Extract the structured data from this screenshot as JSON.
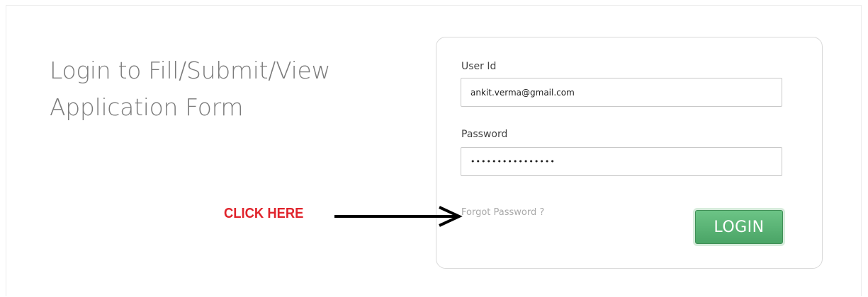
{
  "heading": {
    "line1": "Login to Fill/Submit/View",
    "line2": "Application Form"
  },
  "form": {
    "userid_label": "User Id",
    "userid_value": "ankit.verma@gmail.com",
    "password_label": "Password",
    "password_value": "••••••••••••••••",
    "forgot_link": "Forgot Password ?",
    "login_button": "LOGIN"
  },
  "annotation": {
    "text": "CLICK HERE",
    "icon": "arrow-right-icon"
  },
  "colors": {
    "heading": "#7b7b7b",
    "login_button": "#57b070",
    "annotation": "#e0242c",
    "forgot_link": "#a9a9a9"
  }
}
